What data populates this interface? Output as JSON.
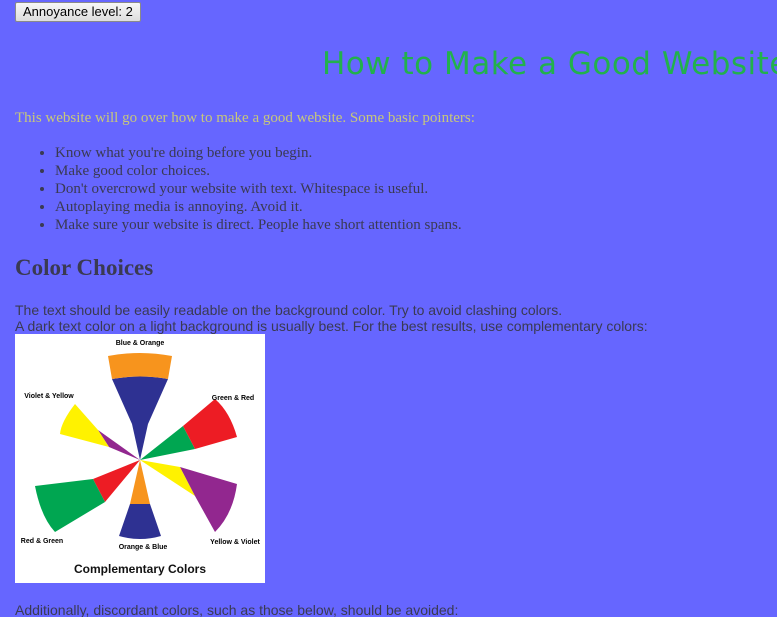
{
  "toolbar": {
    "annoyance_button": "Annoyance level: 2"
  },
  "page": {
    "title": "How to Make a Good Website",
    "intro": "This website will go over how to make a good website. Some basic pointers:",
    "pointers": [
      "Know what you're doing before you begin.",
      "Make good color choices.",
      "Don't overcrowd your website with text. Whitespace is useful.",
      "Autoplaying media is annoying. Avoid it.",
      "Make sure your website is direct. People have short attention spans."
    ]
  },
  "color_section": {
    "heading": "Color Choices",
    "line1": "The text should be easily readable on the background color. Try to avoid clashing colors.",
    "line2": "A dark text color on a light background is usually best. For the best results, use complementary colors:",
    "image": {
      "caption": "Complementary Colors",
      "labels": {
        "top": "Blue & Orange",
        "upper_right": "Green & Red",
        "upper_left": "Violet & Yellow",
        "lower_left": "Red & Green",
        "bottom": "Orange & Blue",
        "lower_right": "Yellow & Violet"
      }
    },
    "line3": "Additionally, discordant colors, such as those below, should be avoided:"
  },
  "colors": {
    "background": "#6666ff",
    "title": "#22b14c",
    "intro": "#c8c87a",
    "text": "#3a3a52",
    "blue": "#2e3192",
    "orange": "#f7941d",
    "green": "#00a651",
    "red": "#ed1c24",
    "yellow": "#fff200",
    "violet": "#92278f"
  }
}
